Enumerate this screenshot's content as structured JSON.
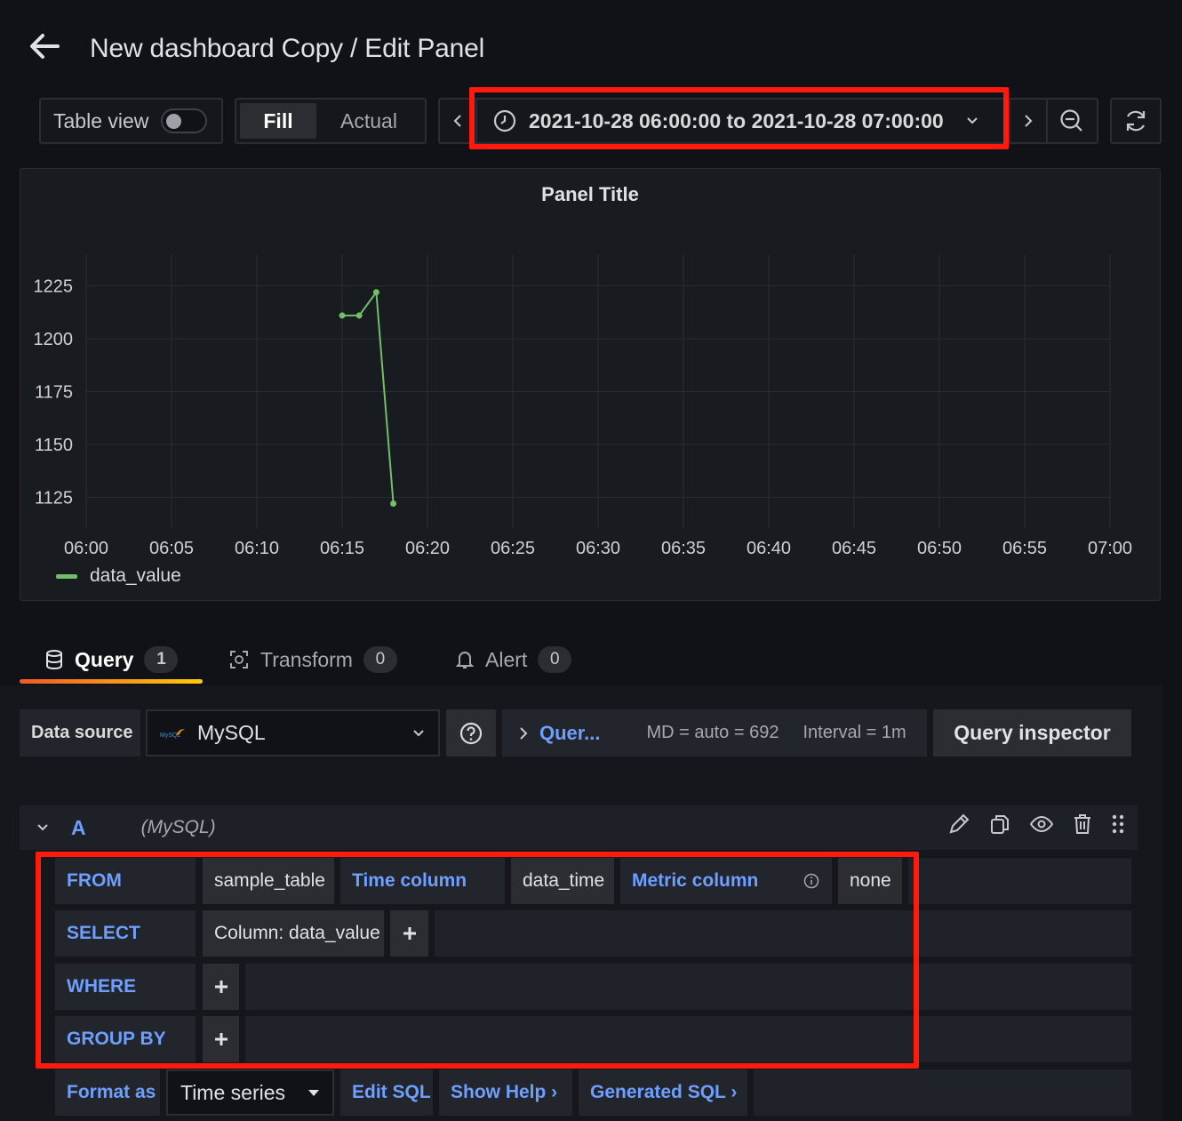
{
  "header": {
    "title": "New dashboard Copy / Edit Panel"
  },
  "toolbar": {
    "table_view_label": "Table view",
    "fill_label": "Fill",
    "actual_label": "Actual",
    "time_range": "2021-10-28 06:00:00 to 2021-10-28 07:00:00"
  },
  "panel": {
    "title": "Panel Title",
    "legend": "data_value"
  },
  "chart_data": {
    "type": "line",
    "title": "Panel Title",
    "x_ticks": [
      "06:00",
      "06:05",
      "06:10",
      "06:15",
      "06:20",
      "06:25",
      "06:30",
      "06:35",
      "06:40",
      "06:45",
      "06:50",
      "06:55",
      "07:00"
    ],
    "y_ticks": [
      "1225",
      "1200",
      "1175",
      "1150",
      "1125"
    ],
    "xlim": [
      "06:00",
      "07:00"
    ],
    "ylim": [
      1110,
      1240
    ],
    "grid": true,
    "legend_position": "bottom-left",
    "series": [
      {
        "name": "data_value",
        "color": "#73bf69",
        "x": [
          "06:15",
          "06:16",
          "06:17",
          "06:18"
        ],
        "values": [
          1211,
          1211,
          1222,
          1122
        ]
      }
    ]
  },
  "tabs": [
    {
      "label": "Query",
      "count": "1"
    },
    {
      "label": "Transform",
      "count": "0"
    },
    {
      "label": "Alert",
      "count": "0"
    }
  ],
  "datasource": {
    "label": "Data source",
    "selected": "MySQL",
    "query_options_link": "Quer...",
    "md": "MD = auto = 692",
    "interval": "Interval = 1m",
    "inspector_label": "Query inspector"
  },
  "query": {
    "letter": "A",
    "datasource": "(MySQL)",
    "from_kw": "FROM",
    "table": "sample_table",
    "time_column_label": "Time column",
    "time_column": "data_time",
    "metric_column_label": "Metric column",
    "metric_column": "none",
    "select_kw": "SELECT",
    "select_value": "Column: data_value",
    "where_kw": "WHERE",
    "group_kw": "GROUP BY",
    "plus": "+",
    "format_label": "Format as",
    "format_value": "Time series",
    "edit_sql": "Edit SQL",
    "show_help": "Show Help ›",
    "generated_sql": "Generated SQL ›"
  }
}
